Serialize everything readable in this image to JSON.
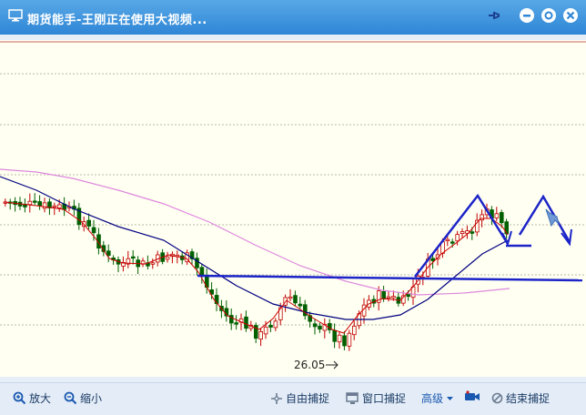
{
  "window": {
    "title": "期货能手-王刚正在使用大视频..."
  },
  "chart": {
    "min_price_label": "26.05",
    "colors": {
      "background": "#fffff2",
      "up_candle": "#c00000",
      "down_candle": "#006000",
      "ma_short": "#cc0000",
      "ma_mid": "#000080",
      "ma_long": "#dd88dd",
      "annotation": "#1c24c8"
    }
  },
  "toolbar": {
    "zoom_in_label": "放大",
    "zoom_out_label": "缩小",
    "free_capture_label": "自由捕捉",
    "window_capture_label": "窗口捕捉",
    "advanced_label": "高级",
    "end_capture_label": "结束捕捉"
  }
}
